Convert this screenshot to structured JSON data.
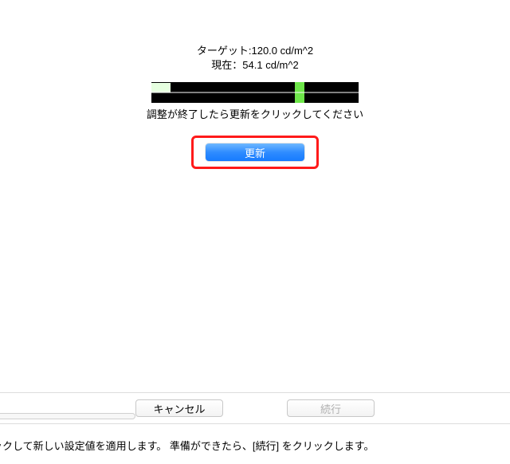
{
  "calibration": {
    "target_label": "ターゲット:",
    "target_value": "120.0 cd/m^2",
    "current_label": "現在：",
    "current_value": "54.1 cd/m^2",
    "instruction": "調整が終了したら更新をクリックしてください",
    "update_button": "更新",
    "current_percent": 9,
    "target_percent": 69
  },
  "buttons": {
    "cancel": "キャンセル",
    "continue": "続行"
  },
  "footer": {
    "text": "ックして新しい設定値を適用します。 準備ができたら、[続行] をクリックします。"
  }
}
